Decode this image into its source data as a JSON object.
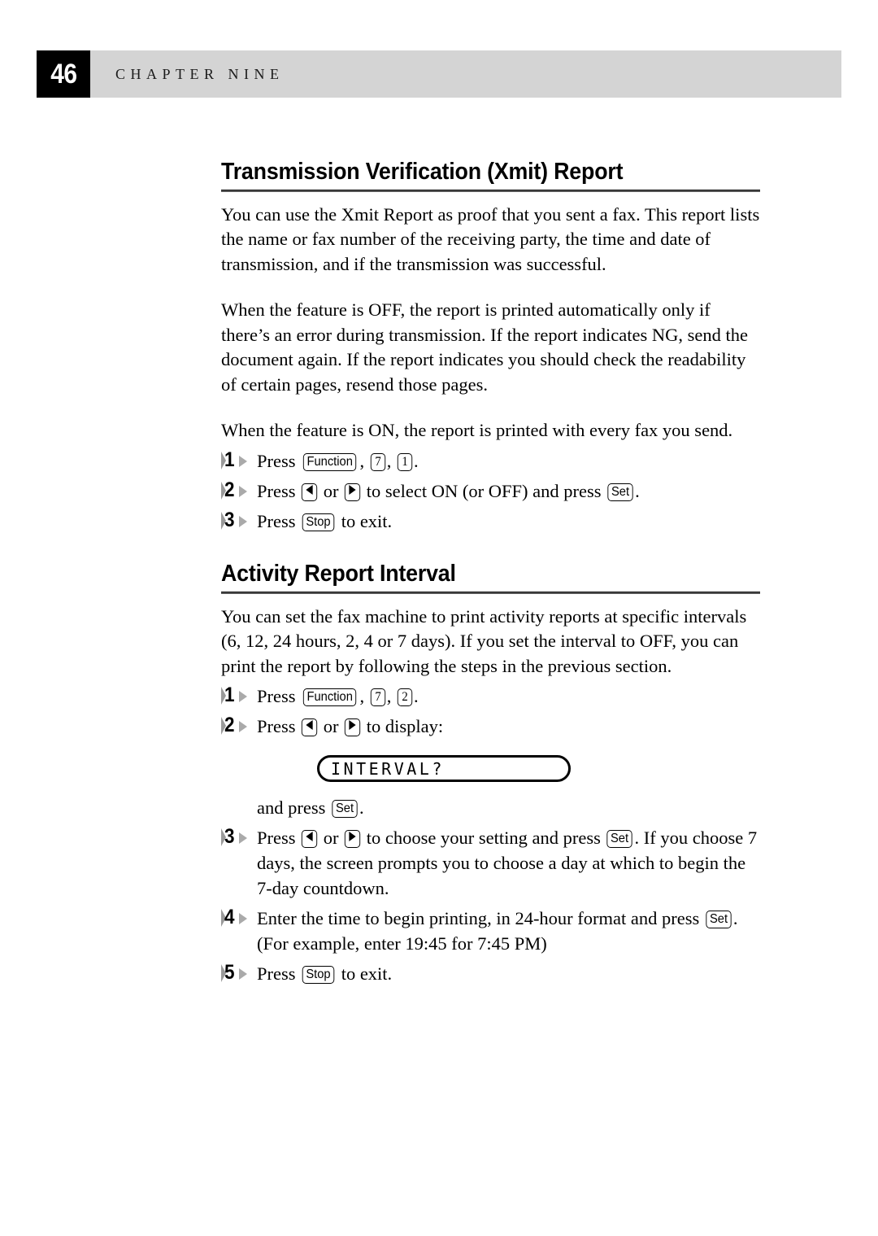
{
  "header": {
    "page_number": "46",
    "chapter_label": "CHAPTER NINE"
  },
  "sections": [
    {
      "heading": "Transmission Verification (Xmit) Report",
      "paragraphs": [
        "You can use the Xmit Report as proof that you sent a fax.  This report lists the name or fax number of the receiving party, the time and date of transmission, and if the transmission was successful.",
        "When the feature is OFF, the report is printed automatically only if there’s an error during transmission.  If the report indicates NG, send the document again.  If the report indicates you should check the readability of certain pages, resend those pages.",
        "When the feature is ON, the report is printed with every fax you send."
      ],
      "steps": [
        {
          "number": "1",
          "prefix": "Press ",
          "keys": [
            "Function",
            "7",
            "1"
          ],
          "suffix": "."
        },
        {
          "number": "2",
          "prefix": "Press ",
          "arrow_left": "left-arrow",
          "mid": " or ",
          "arrow_right": "right-arrow",
          "after_arrows": " to select ON (or OFF) and press ",
          "key": "Set",
          "suffix": "."
        },
        {
          "number": "3",
          "prefix": "Press ",
          "key": "Stop",
          "suffix": " to exit."
        }
      ]
    },
    {
      "heading": "Activity Report Interval",
      "paragraphs": [
        "You can set the fax machine to print activity reports at specific intervals (6, 12, 24 hours, 2, 4 or 7 days).  If you set the interval to OFF, you can print the report by following the steps in the previous section."
      ],
      "steps": [
        {
          "number": "1",
          "prefix": "Press ",
          "keys": [
            "Function",
            "7",
            "2"
          ],
          "suffix": "."
        },
        {
          "number": "2",
          "prefix": "Press ",
          "mid": " or ",
          "after_arrows": " to display:",
          "lcd_text": "INTERVAL?",
          "tail_prefix": "and press ",
          "tail_key": "Set",
          "tail_suffix": "."
        },
        {
          "number": "3",
          "prefix": "Press ",
          "mid": " or ",
          "after_arrows": " to choose your setting and press ",
          "key": "Set",
          "suffix": ".  If you choose 7 days, the screen prompts you to choose a day at which to begin the 7-day countdown."
        },
        {
          "number": "4",
          "prefix": "Enter the time to begin printing, in 24-hour format and press ",
          "key": "Set",
          "suffix": ".  (For example, enter 19:45 for 7:45 PM)"
        },
        {
          "number": "5",
          "prefix": "Press ",
          "key": "Stop",
          "suffix": " to exit."
        }
      ]
    }
  ],
  "colors": {
    "header_bar": "#d4d4d4",
    "page_box": "#000000",
    "marker_gray": "#a0a0a0"
  }
}
